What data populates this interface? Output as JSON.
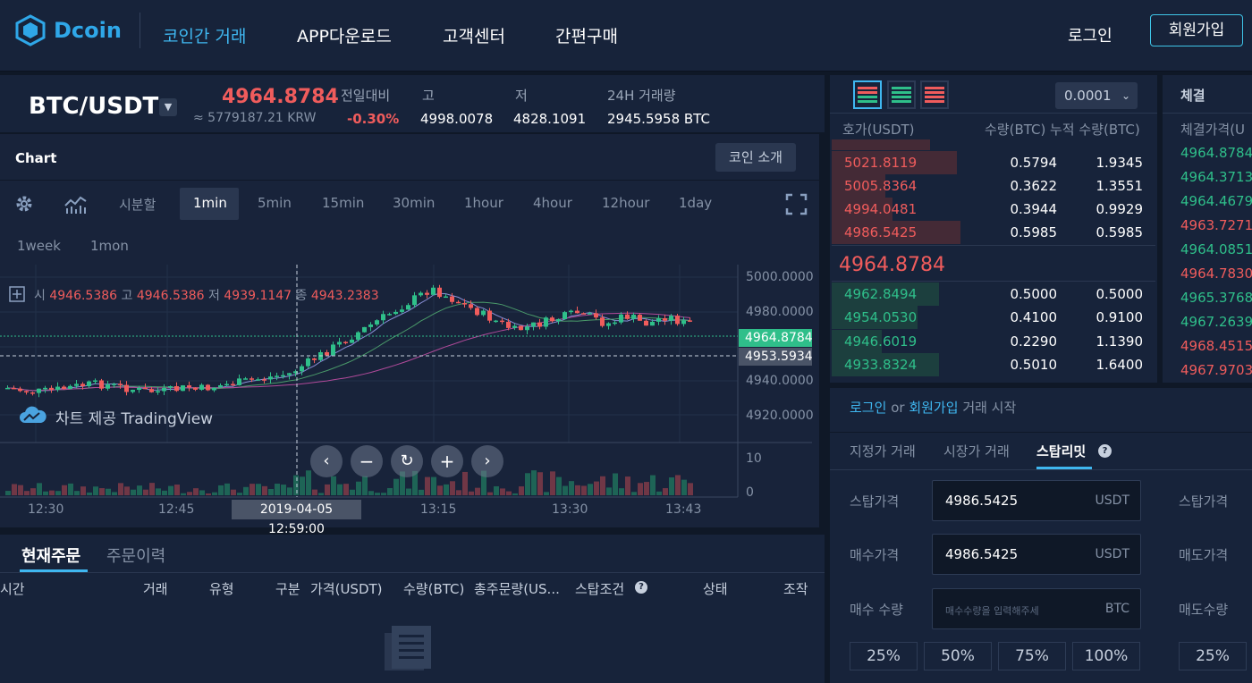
{
  "nav": {
    "logo_text": "Dcoin",
    "items": [
      "코인간 거래",
      "APP다운로드",
      "고객센터",
      "간편구매"
    ],
    "login": "로그인",
    "signup": "회원가입"
  },
  "ticker": {
    "pair": "BTC/USDT",
    "last_price": "4964.8784",
    "krw": "≈ 5779187.21 KRW",
    "change_label": "전일대비",
    "change_value": "-0.30%",
    "high_label": "고",
    "high_value": "4998.0078",
    "low_label": "저",
    "low_value": "4828.1091",
    "vol_label": "24H 거래량",
    "vol_value": "2945.5958 BTC"
  },
  "chart": {
    "title": "Chart",
    "coin_intro": "코인 소개",
    "timeframes": [
      "시분할",
      "1min",
      "5min",
      "15min",
      "30min",
      "1hour",
      "4hour",
      "12hour",
      "1day"
    ],
    "timeframes2": [
      "1week",
      "1mon"
    ],
    "ohlc": {
      "o_label": "시",
      "o": "4946.5386",
      "h_label": "고",
      "h": "4946.5386",
      "l_label": "저",
      "l": "4939.1147",
      "c_label": "종",
      "c": "4943.2383"
    },
    "watermark": "차트 제공 TradingView",
    "price_ticks": [
      "5000.0000",
      "4980.0000",
      "4940.0000",
      "4920.0000"
    ],
    "last_tag": "4964.8784",
    "cross_tag": "4953.5934",
    "vol_ticks": [
      "10",
      "0"
    ],
    "time_ticks": [
      "12:30",
      "12:45",
      "13:15",
      "13:30",
      "13:43"
    ],
    "cross_time": "2019-04-05 12:59:00"
  },
  "orderbook": {
    "precision": "0.0001",
    "col_price": "호가(USDT)",
    "col_qty": "수량(BTC)",
    "col_cum": "누적 수량(BTC)",
    "asks": [
      {
        "price": "5021.8119",
        "qty": "0.5794",
        "cum": "1.9345"
      },
      {
        "price": "5005.8364",
        "qty": "0.3622",
        "cum": "1.3551"
      },
      {
        "price": "4994.0481",
        "qty": "0.3944",
        "cum": "0.9929"
      },
      {
        "price": "4986.5425",
        "qty": "0.5985",
        "cum": "0.5985"
      }
    ],
    "mid": "4964.8784",
    "bids": [
      {
        "price": "4962.8494",
        "qty": "0.5000",
        "cum": "0.5000"
      },
      {
        "price": "4954.0530",
        "qty": "0.4100",
        "cum": "0.9100"
      },
      {
        "price": "4946.6019",
        "qty": "0.2290",
        "cum": "1.1390"
      },
      {
        "price": "4933.8324",
        "qty": "0.5010",
        "cum": "1.6400"
      }
    ]
  },
  "trades": {
    "title": "체결",
    "col_price": "체결가격(U",
    "rows": [
      {
        "p": "4964.8784",
        "side": "buy"
      },
      {
        "p": "4964.3713",
        "side": "buy"
      },
      {
        "p": "4964.4679",
        "side": "buy"
      },
      {
        "p": "4963.7271",
        "side": "sell"
      },
      {
        "p": "4964.0851",
        "side": "buy"
      },
      {
        "p": "4964.7830",
        "side": "sell"
      },
      {
        "p": "4965.3768",
        "side": "buy"
      },
      {
        "p": "4967.2639",
        "side": "buy"
      },
      {
        "p": "4968.4515",
        "side": "sell"
      },
      {
        "p": "4967.9703",
        "side": "sell"
      }
    ]
  },
  "form": {
    "login_link": "로그인",
    "or": "or",
    "signup_link": "회원가입",
    "start": "거래 시작",
    "tabs": [
      "지정가 거래",
      "시장가 거래",
      "스탑리밋"
    ],
    "stop_label": "스탑가격",
    "stop_value": "4986.5425",
    "buy_price_label": "매수가격",
    "buy_price_value": "4986.5425",
    "buy_qty_label": "매수 수량",
    "buy_qty_placeholder": "매수수량을 입력해주세",
    "unit_usdt": "USDT",
    "unit_btc": "BTC",
    "pcts": [
      "25%",
      "50%",
      "75%",
      "100%"
    ],
    "right_stop_label": "스탑가격",
    "right_sell_price_label": "매도가격",
    "right_sell_qty_label": "매도수량",
    "right_pct": "25%"
  },
  "orders": {
    "tabs": [
      "현재주문",
      "주문이력"
    ],
    "headers": [
      "시간",
      "거래",
      "유형",
      "구분",
      "가격(USDT)",
      "수량(BTC)",
      "총주문량(US...",
      "스탑조건",
      "상태",
      "조작"
    ]
  }
}
